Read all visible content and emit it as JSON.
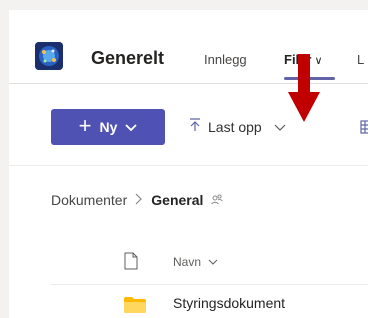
{
  "team": {
    "name": "Generelt",
    "logo_icon": "team-logo-icon"
  },
  "tabs": [
    {
      "label": "Innlegg",
      "active": false
    },
    {
      "label": "Filer",
      "active": true
    },
    {
      "label": "L",
      "active": false
    }
  ],
  "toolbar": {
    "new_label": "Ny",
    "upload_label": "Last opp",
    "next_icon": "grid-icon"
  },
  "breadcrumb": {
    "root": "Dokumenter",
    "current": "General"
  },
  "list": {
    "column_name": "Navn",
    "rows": [
      {
        "name": "Styringsdokument",
        "type": "folder"
      }
    ]
  },
  "colors": {
    "accent": "#4f52b2",
    "tab_underline": "#6264a7",
    "folder": "#ffb900",
    "annotation_arrow": "#c00000"
  },
  "annotation": {
    "icon": "red-down-arrow-icon",
    "points_to": "tab-filer"
  }
}
